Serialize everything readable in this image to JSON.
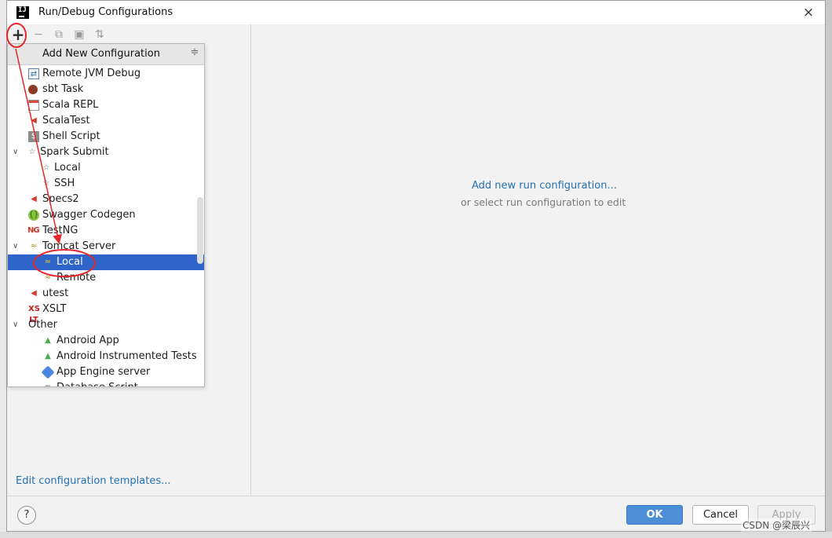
{
  "window": {
    "title": "Run/Debug Configurations",
    "app_logo": "IJ",
    "close_icon": "×"
  },
  "toolbar": {
    "add": "+",
    "remove": "−",
    "copy": "⧉",
    "folder": "▣",
    "sort": "⇅"
  },
  "popup": {
    "header": "Add New Configuration",
    "collapse_icon": "≑",
    "items": [
      {
        "label": "Remote JVM Debug",
        "icon": "remote-jvm-debug-icon"
      },
      {
        "label": "sbt Task",
        "icon": "sbt-icon"
      },
      {
        "label": "Scala REPL",
        "icon": "scala-repl-icon"
      },
      {
        "label": "ScalaTest",
        "icon": "scalatest-icon"
      },
      {
        "label": "Shell Script",
        "icon": "shell-script-icon"
      },
      {
        "label": "Spark Submit",
        "icon": "spark-icon",
        "expanded": true
      },
      {
        "label": "Local",
        "icon": "spark-local-icon"
      },
      {
        "label": "SSH",
        "icon": "spark-ssh-icon"
      },
      {
        "label": "Specs2",
        "icon": "specs2-icon"
      },
      {
        "label": "Swagger Codegen",
        "icon": "swagger-icon"
      },
      {
        "label": "TestNG",
        "icon": "testng-icon"
      },
      {
        "label": "Tomcat Server",
        "icon": "tomcat-icon",
        "expanded": true
      },
      {
        "label": "Local",
        "icon": "tomcat-local-icon",
        "selected": true
      },
      {
        "label": "Remote",
        "icon": "tomcat-remote-icon"
      },
      {
        "label": "utest",
        "icon": "utest-icon"
      },
      {
        "label": "XSLT",
        "icon": "xslt-icon"
      },
      {
        "label": "Other",
        "expanded": true
      },
      {
        "label": "Android App",
        "icon": "android-icon"
      },
      {
        "label": "Android Instrumented Tests",
        "icon": "android-tests-icon"
      },
      {
        "label": "App Engine server",
        "icon": "app-engine-icon"
      },
      {
        "label": "Database Script",
        "icon": "database-script-icon"
      }
    ]
  },
  "right": {
    "add_link": "Add new run configuration...",
    "hint": "or select run configuration to edit"
  },
  "left_footer": {
    "edit_templates": "Edit configuration templates..."
  },
  "footer": {
    "help": "?",
    "ok": "OK",
    "cancel": "Cancel",
    "apply": "Apply"
  },
  "watermark": "CSDN @梁辰兴",
  "colors": {
    "selection": "#2f65ca",
    "link": "#2470b3",
    "ok_button": "#4c8ed8",
    "annotation": "#e8262a"
  }
}
